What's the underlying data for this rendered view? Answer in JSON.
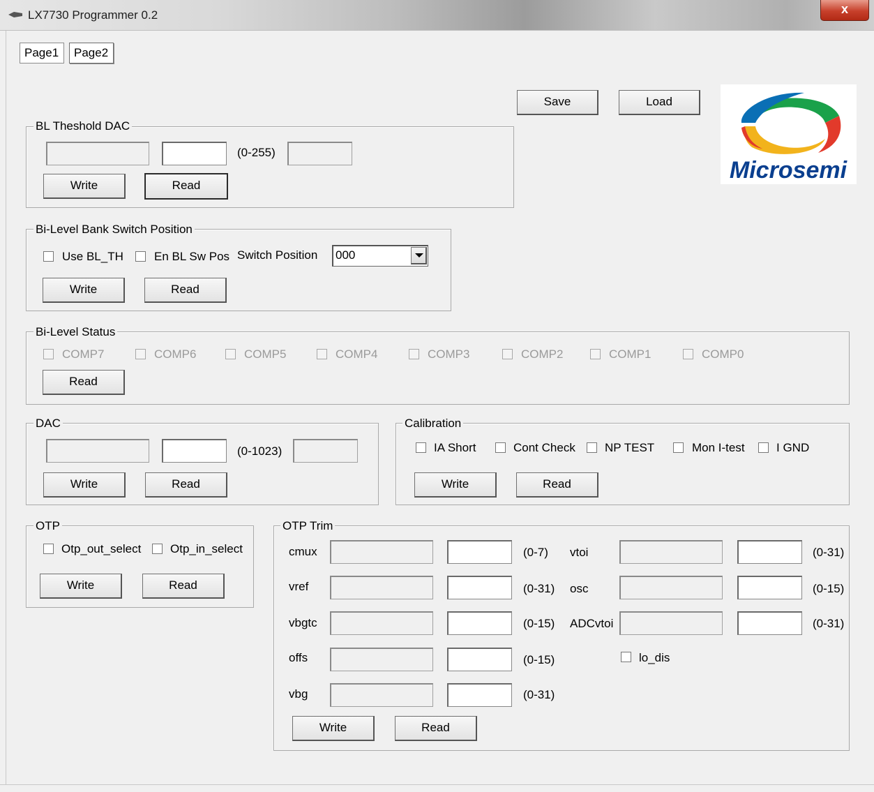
{
  "window": {
    "title": "LX7730 Programmer 0.2",
    "close_label": "x"
  },
  "tabs": [
    {
      "label": "Page1"
    },
    {
      "label": "Page2"
    }
  ],
  "toolbar": {
    "save_label": "Save",
    "load_label": "Load"
  },
  "logo": {
    "text": "Microsemi",
    "colors": [
      "#1aa14a",
      "#0a6fb5",
      "#e23a2b",
      "#f2b31c"
    ]
  },
  "bl_threshold": {
    "title": "BL Theshold DAC",
    "range": "(0-255)",
    "write_label": "Write",
    "read_label": "Read"
  },
  "bank_switch": {
    "title": "Bi-Level Bank Switch Position",
    "use_bl_th_label": "Use BL_TH",
    "en_bl_sw_pos_label": "En BL Sw Pos",
    "switch_position_label": "Switch Position",
    "switch_position_value": "000",
    "write_label": "Write",
    "read_label": "Read"
  },
  "bilevel_status": {
    "title": "Bi-Level Status",
    "comps": [
      "COMP7",
      "COMP6",
      "COMP5",
      "COMP4",
      "COMP3",
      "COMP2",
      "COMP1",
      "COMP0"
    ],
    "read_label": "Read"
  },
  "dac": {
    "title": "DAC",
    "range": "(0-1023)",
    "write_label": "Write",
    "read_label": "Read"
  },
  "calibration": {
    "title": "Calibration",
    "options": [
      "IA Short",
      "Cont Check",
      "NP TEST",
      "Mon I-test",
      "I GND"
    ],
    "write_label": "Write",
    "read_label": "Read"
  },
  "otp": {
    "title": "OTP",
    "out_select_label": "Otp_out_select",
    "in_select_label": "Otp_in_select",
    "write_label": "Write",
    "read_label": "Read"
  },
  "otp_trim": {
    "title": "OTP Trim",
    "left_rows": [
      {
        "name": "cmux",
        "range": "(0-7)"
      },
      {
        "name": "vref",
        "range": "(0-31)"
      },
      {
        "name": "vbgtc",
        "range": "(0-15)"
      },
      {
        "name": "offs",
        "range": "(0-15)"
      },
      {
        "name": "vbg",
        "range": "(0-31)"
      }
    ],
    "right_rows": [
      {
        "name": "vtoi",
        "range": "(0-31)"
      },
      {
        "name": "osc",
        "range": "(0-15)"
      },
      {
        "name": "ADCvtoi",
        "range": "(0-31)"
      }
    ],
    "lo_dis_label": "lo_dis",
    "write_label": "Write",
    "read_label": "Read"
  }
}
